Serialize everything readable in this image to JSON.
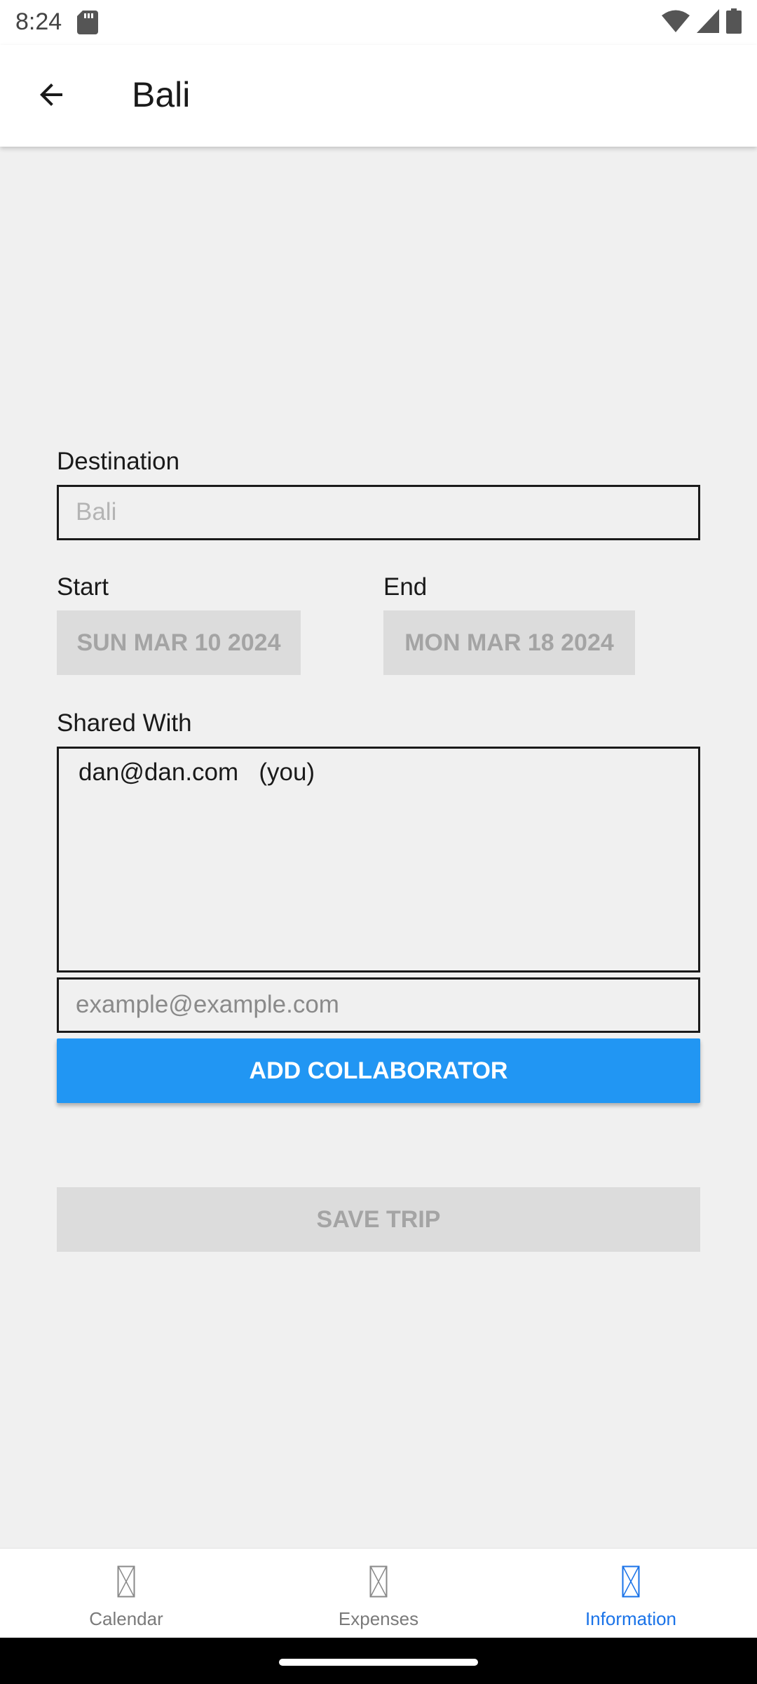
{
  "status_bar": {
    "time": "8:24"
  },
  "app_bar": {
    "title": "Bali"
  },
  "form": {
    "destination_label": "Destination",
    "destination_placeholder": "Bali",
    "start_label": "Start",
    "start_value": "SUN MAR 10 2024",
    "end_label": "End",
    "end_value": "MON MAR 18 2024",
    "shared_label": "Shared With",
    "shared_list": [
      "dan@dan.com   (you)"
    ],
    "email_placeholder": "example@example.com",
    "add_button": "ADD COLLABORATOR",
    "save_button": "SAVE TRIP"
  },
  "bottom_nav": {
    "items": [
      {
        "label": "Calendar",
        "active": false
      },
      {
        "label": "Expenses",
        "active": false
      },
      {
        "label": "Information",
        "active": true
      }
    ]
  },
  "colors": {
    "accent": "#2196f3",
    "active_nav": "#1a73e8",
    "background": "#f0f0f0"
  }
}
